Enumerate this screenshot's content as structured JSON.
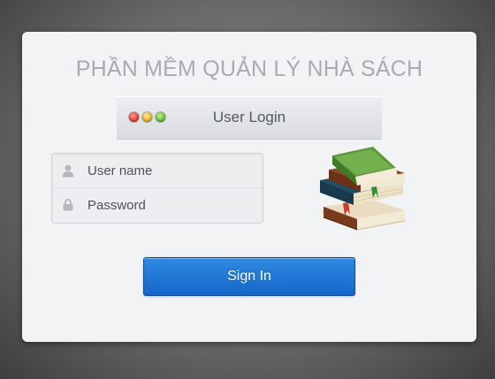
{
  "app": {
    "title": "PHẦN MỀM QUẢN LÝ NHÀ SÁCH"
  },
  "login_window": {
    "title": "User Login",
    "window_buttons": [
      "close",
      "minimize",
      "maximize"
    ]
  },
  "form": {
    "username_placeholder": "User name",
    "password_placeholder": "Password",
    "username_icon": "user-icon",
    "password_icon": "lock-icon"
  },
  "actions": {
    "signin_label": "Sign In"
  },
  "illustration": {
    "icon": "books-stack-icon"
  },
  "colors": {
    "accent": "#1f74d4",
    "title_gray": "#a9abae"
  }
}
